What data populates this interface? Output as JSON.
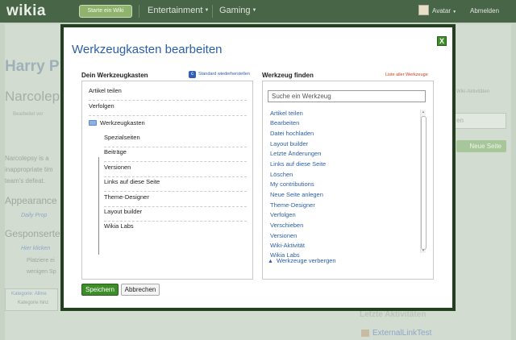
{
  "topbar": {
    "logo": "wikia",
    "start_wiki": "Starte ein Wiki",
    "nav": [
      "Entertainment",
      "Gaming"
    ],
    "avatar_label": "Avatar",
    "logout": "Abmelden"
  },
  "background": {
    "title": "Harry P",
    "subtitle": "Narcolep",
    "meta": "Bearbeitet vor",
    "text_lines": [
      "Narcolepsy is a",
      "inappropriate tim",
      "team's defeat."
    ],
    "heading_appearances": "Appearance",
    "link_daily": "Daily Prop",
    "heading_sponsored": "Gesponserte",
    "link_hier": "Hier klicken",
    "text_platz": [
      "Platziere ei",
      "wenigen Sp"
    ],
    "category_label": "Kategorie: Allme",
    "category_badge": "Kategorie hinz",
    "wiki_aktivitaet": "Wiki-Aktivitäten",
    "search_label": "en",
    "neue_seite": "Neue Seite",
    "letzte_aktivitaeten": "Letzte Aktivitäten",
    "external_link": "ExternalLinkTest"
  },
  "dialog": {
    "title": "Werkzeugkasten bearbeiten",
    "close_label": "X",
    "left": {
      "heading": "Dein Werkzeugkasten",
      "restore_label": "Standard wiederherstellen",
      "items": [
        "Artikel teilen",
        "Verfolgen"
      ],
      "folder_label": "Werkzeugkasten",
      "folder_items": [
        "Spezialseiten",
        "Beiträge",
        "Versionen",
        "Links auf diese Seite",
        "Theme-Designer",
        "Layout builder",
        "Wikia Labs"
      ]
    },
    "right": {
      "heading": "Werkzeug finden",
      "all_tools_label": "Liste aller Werkzeuge",
      "search_placeholder": "Suche ein Werkzeug",
      "items": [
        "Artikel teilen",
        "Bearbeiten",
        "Datei hochladen",
        "Layout builder",
        "Letzte Änderungen",
        "Links auf diese Seite",
        "Löschen",
        "My contributions",
        "Neue Seite anlegen",
        "Theme-Designer",
        "Verfolgen",
        "Verschieben",
        "Versionen",
        "Wiki-Aktivität",
        "Wikia Labs"
      ],
      "hide_label": "Werkzeuge verbergen"
    },
    "save_label": "Speichern",
    "cancel_label": "Abbrechen"
  }
}
